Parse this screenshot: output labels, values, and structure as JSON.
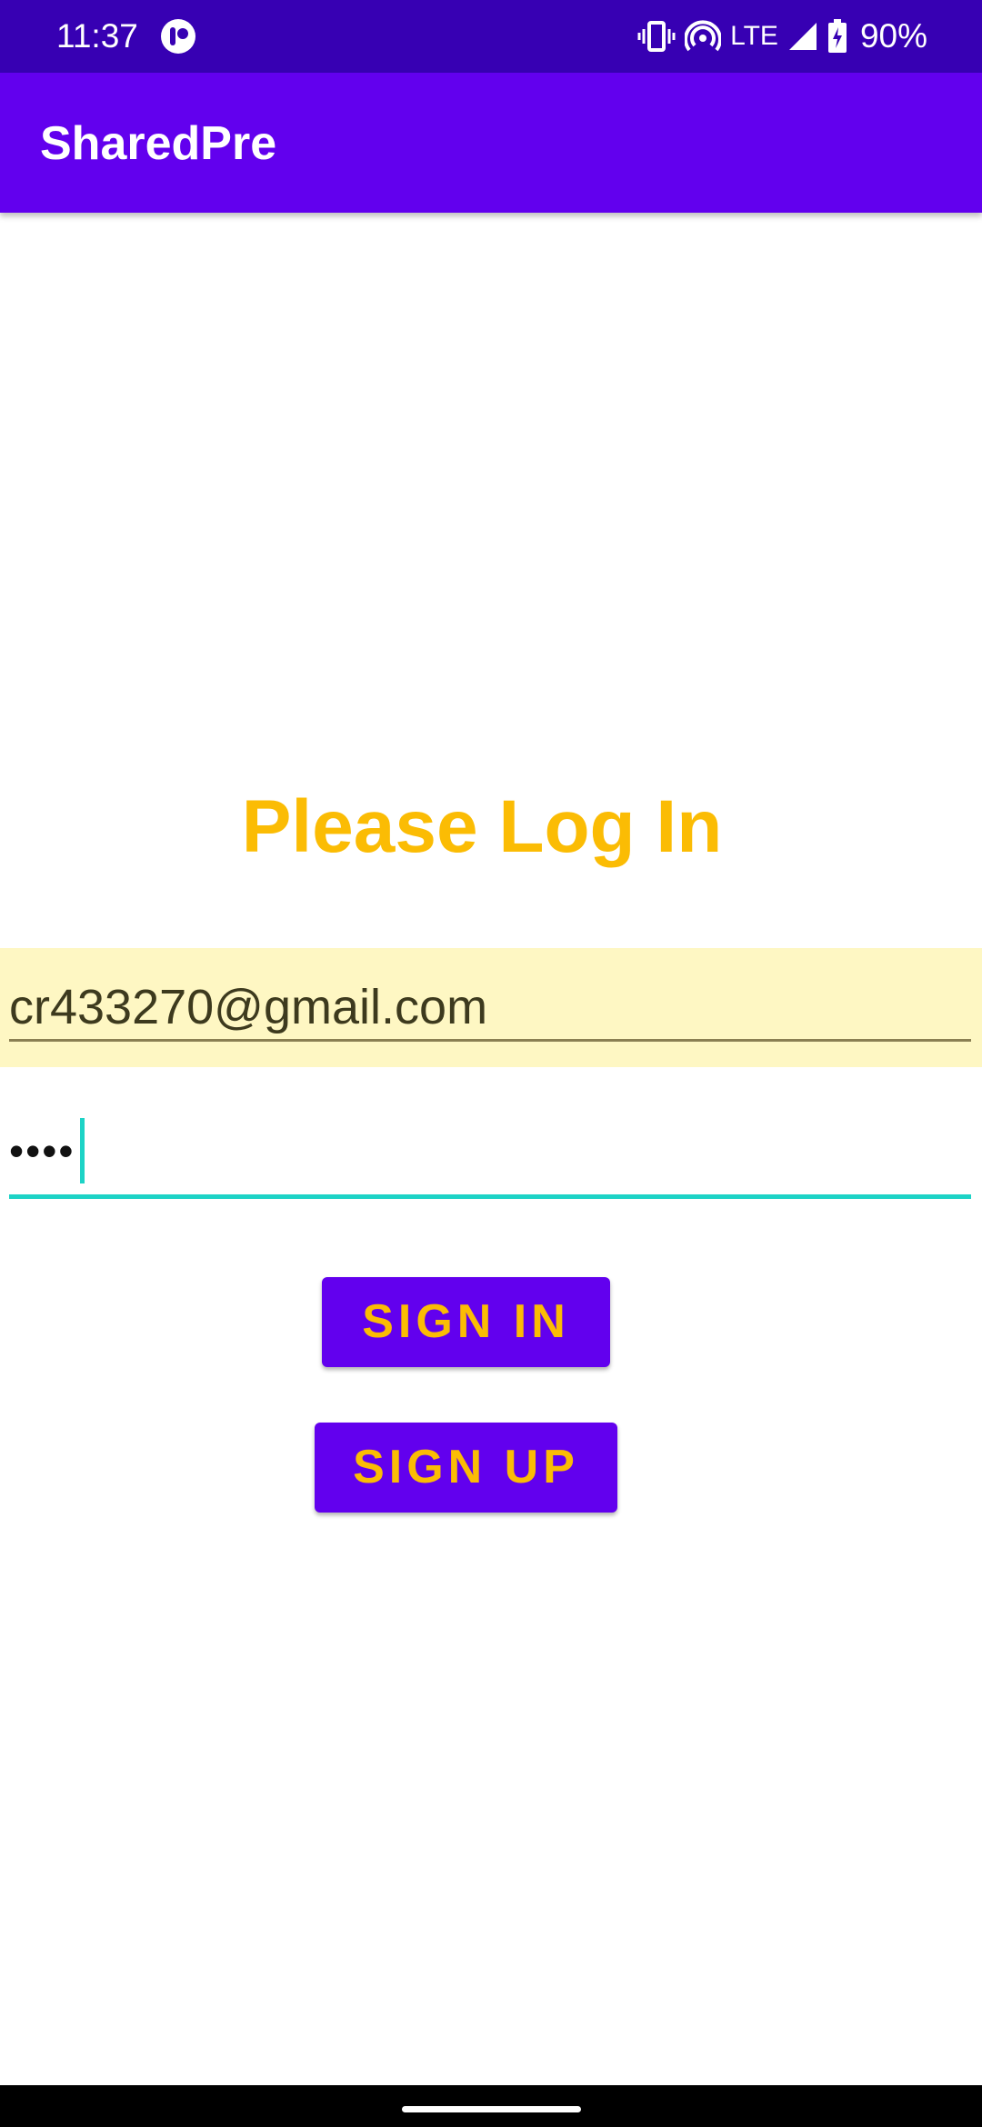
{
  "status_bar": {
    "time": "11:37",
    "network": "LTE",
    "battery": "90%",
    "icons": [
      "app-notification-icon",
      "vibrate-icon",
      "hotspot-icon",
      "signal-icon",
      "battery-charging-icon"
    ]
  },
  "app_bar": {
    "title": "SharedPre"
  },
  "login": {
    "heading": "Please Log In",
    "email_value": "cr433270@gmail.com",
    "password_masked": "••••",
    "signin_label": "SIGN IN",
    "signup_label": "SIGN UP"
  },
  "colors": {
    "status_bar": "#3700b3",
    "primary": "#6200ee",
    "accent_text": "#fbbc04",
    "email_highlight": "#fef7c3",
    "focus_underline": "#1dd3c6"
  }
}
